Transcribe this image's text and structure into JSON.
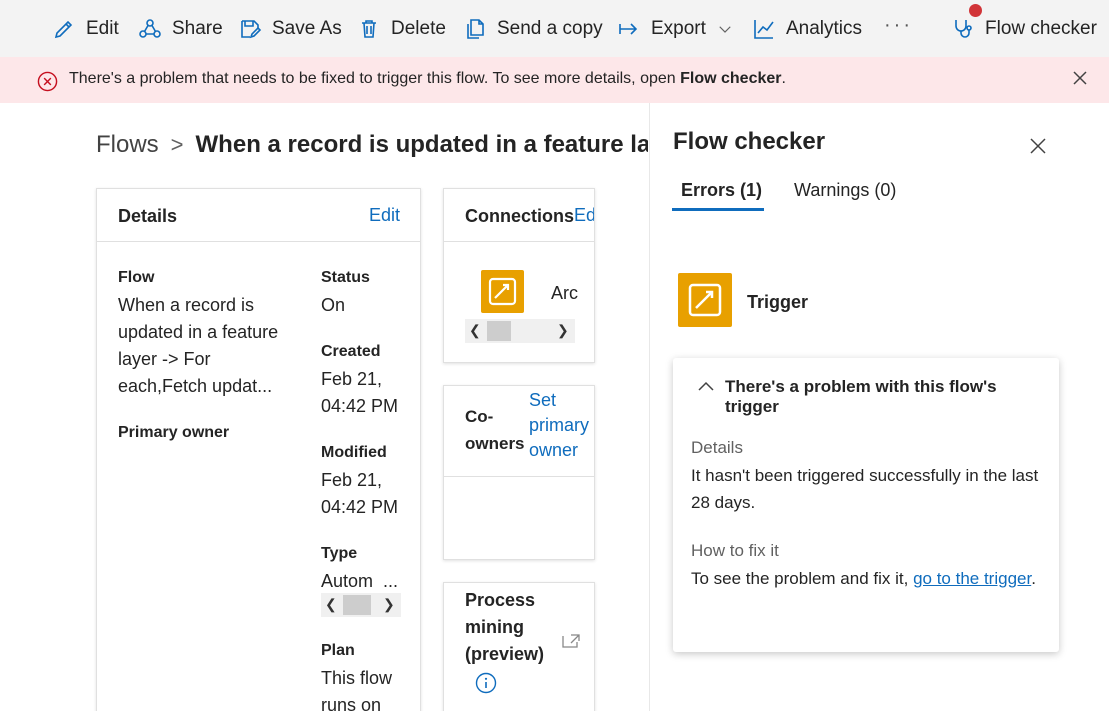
{
  "toolbar": {
    "edit": "Edit",
    "share": "Share",
    "save_as": "Save As",
    "delete": "Delete",
    "send_copy": "Send a copy",
    "export": "Export",
    "analytics": "Analytics",
    "more": "···",
    "flow_checker": "Flow checker"
  },
  "banner": {
    "message": "There's a problem that needs to be fixed to trigger this flow. To see more details, open ",
    "message_bold": "Flow checker",
    "message_end": "."
  },
  "breadcrumb": {
    "root": "Flows",
    "separator": ">",
    "title": "When a record is updated in a feature layer -> For each,Fetch updates"
  },
  "details_card": {
    "title": "Details",
    "edit": "Edit",
    "flow_label": "Flow",
    "flow_lines": [
      "When a record is",
      "updated in a feature",
      "layer -> For",
      "each,Fetch updat..."
    ],
    "primary_owner_label": "Primary owner",
    "status_label": "Status",
    "status_value": "On",
    "created_label": "Created",
    "created_lines": [
      "Feb 21,",
      "04:42 PM"
    ],
    "modified_label": "Modified",
    "modified_lines": [
      "Feb 21,",
      "04:42 PM"
    ],
    "type_label": "Type",
    "type_value": "Autom  ...",
    "plan_label": "Plan",
    "plan_lines": [
      "This flow",
      "runs on"
    ]
  },
  "connections_card": {
    "title": "Connections",
    "edit": "Edit",
    "connector_name": "Arc"
  },
  "coowners_card": {
    "title_lines": [
      "Co-",
      "owners"
    ],
    "action_lines": [
      "Set",
      "primary",
      "owner"
    ]
  },
  "process_card": {
    "title_lines": [
      "Process",
      "mining",
      "(preview)"
    ]
  },
  "flow_checker": {
    "title": "Flow checker",
    "tab_errors": "Errors (1)",
    "tab_warnings": "Warnings (0)",
    "trigger_label": "Trigger",
    "problem": {
      "title": "There's a problem with this flow's trigger",
      "details_label": "Details",
      "details_text": "It hasn't been triggered successfully in the last 28 days.",
      "fix_label": "How to fix it",
      "fix_text": "To see the problem and fix it, ",
      "fix_link": "go to the trigger",
      "fix_end": "."
    }
  },
  "colors": {
    "accent": "#0f6cbd",
    "error": "#d13438",
    "banner_bg": "#fde7e9",
    "trigger_icon": "#e8a000"
  }
}
